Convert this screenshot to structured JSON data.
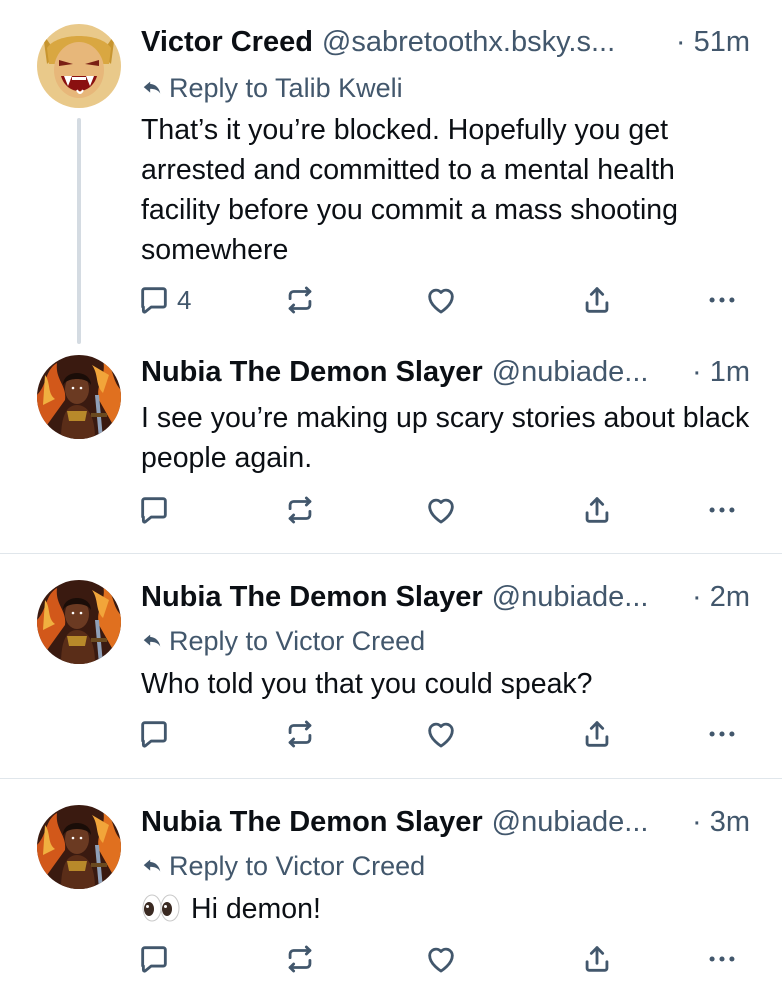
{
  "colors": {
    "text": "#0b0f14",
    "muted": "#42576c",
    "thread_line": "#d4dbe2",
    "divider": "#e0e6eb"
  },
  "posts": [
    {
      "author": "Victor Creed",
      "handle": "@sabretoothx.bsky.s...",
      "time": "· 51m",
      "reply_to": "Reply to Talib Kweli",
      "text": "That’s it you’re blocked. Hopefully you get arrested and committed to a mental health facility before you commit a mass shooting somewhere",
      "reply_count": "4",
      "avatar_icon": "avatar-sabretooth-icon"
    },
    {
      "author": "Nubia The Demon Slayer",
      "handle": "@nubiade...",
      "time": "· 1m",
      "text": "I see you’re making up scary stories about black people again.",
      "avatar_icon": "avatar-nubia-icon"
    },
    {
      "author": "Nubia The Demon Slayer",
      "handle": "@nubiade...",
      "time": "· 2m",
      "reply_to": "Reply to Victor Creed",
      "text": "Who told you that you could speak?",
      "avatar_icon": "avatar-nubia-icon"
    },
    {
      "author": "Nubia The Demon Slayer",
      "handle": "@nubiade...",
      "time": "· 3m",
      "reply_to": "Reply to Victor Creed",
      "text": "Hi demon!",
      "emoji_icon": "eyes-emoji-icon",
      "avatar_icon": "avatar-nubia-icon"
    }
  ]
}
